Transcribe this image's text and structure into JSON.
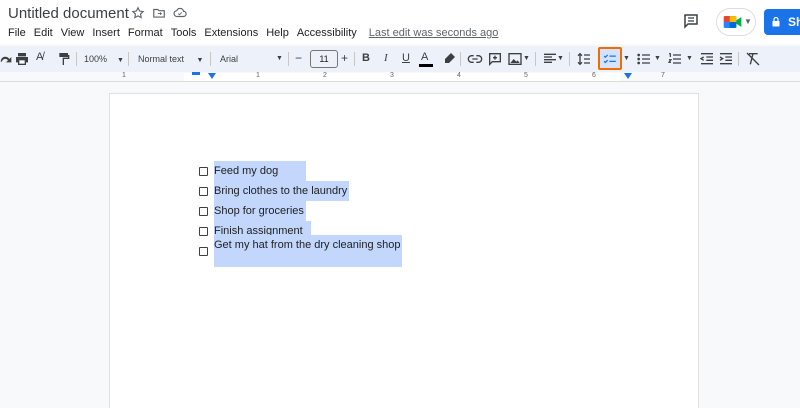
{
  "header": {
    "title": "Untitled document",
    "last_edit": "Last edit was seconds ago",
    "share_label": "Sh"
  },
  "menu": {
    "items": [
      "File",
      "Edit",
      "View",
      "Insert",
      "Format",
      "Tools",
      "Extensions",
      "Help",
      "Accessibility"
    ]
  },
  "toolbar": {
    "zoom": "100%",
    "style": "Normal text",
    "font": "Arial",
    "size": "11",
    "minus": "−",
    "plus": "+",
    "bold": "B",
    "italic": "I",
    "underline": "U",
    "text_color_glyph": "A"
  },
  "ruler": {
    "numbers": [
      "1",
      "1",
      "2",
      "3",
      "4",
      "5",
      "6",
      "7"
    ]
  },
  "document": {
    "checklist": [
      "Feed my dog",
      "Bring clothes to the laundry",
      "Shop for groceries",
      "Finish assignment",
      "Get my hat from the dry cleaning shop"
    ]
  },
  "colors": {
    "selection": "#c2d7fb",
    "highlight_border": "#ef6c00",
    "share": "#1a73e8"
  }
}
